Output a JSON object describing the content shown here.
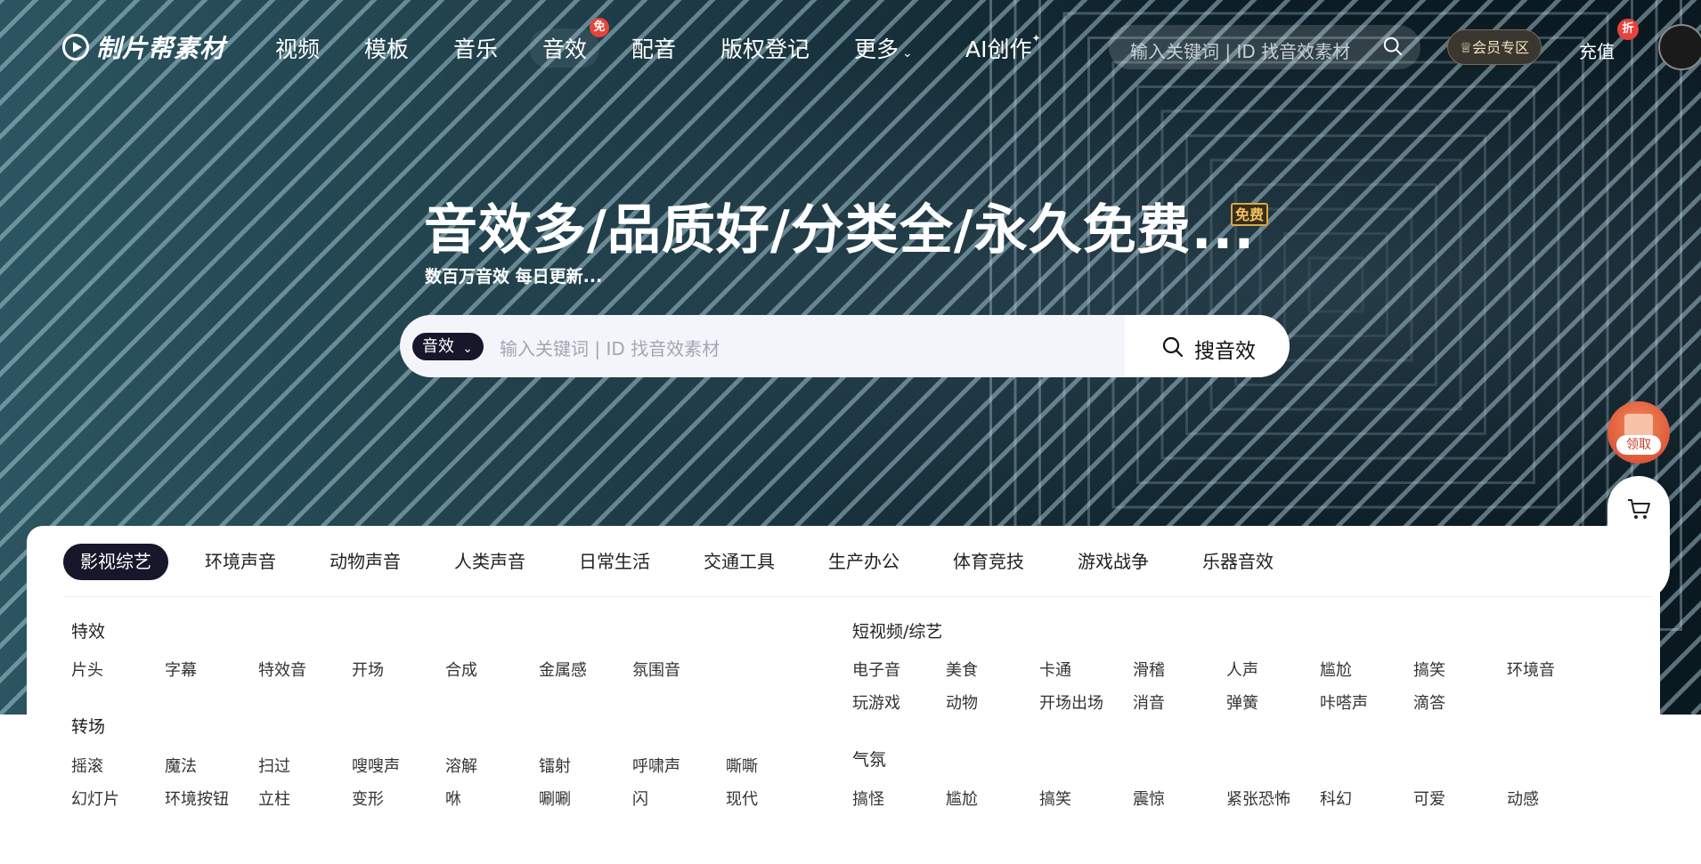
{
  "nav": {
    "logo_text": "制片帮素材",
    "items": [
      {
        "label": "视频"
      },
      {
        "label": "模板"
      },
      {
        "label": "音乐"
      },
      {
        "label": "音效",
        "badge": "免"
      },
      {
        "label": "配音"
      },
      {
        "label": "版权登记"
      },
      {
        "label": "更多"
      },
      {
        "label": "AI创作"
      }
    ],
    "search_placeholder": "输入关键词 | ID 找音效素材",
    "vip_label": "会员专区",
    "recharge_label": "充值",
    "recharge_badge": "折"
  },
  "hero": {
    "headline": "音效多/品质好/分类全/永久免费...",
    "free_tag": "免费",
    "subheadline": "数百万音效 每日更新...",
    "search": {
      "type_label": "音效",
      "placeholder": "输入关键词 | ID 找音效素材",
      "button_label": "搜音效"
    }
  },
  "floating": {
    "gift_label": "领取",
    "icons": [
      "cart-icon",
      "headset-icon"
    ]
  },
  "categories": {
    "tabs": [
      "影视综艺",
      "环境声音",
      "动物声音",
      "人类声音",
      "日常生活",
      "交通工具",
      "生产办公",
      "体育竞技",
      "游戏战争",
      "乐器音效"
    ],
    "active_tab": "影视综艺",
    "groups": [
      {
        "title": "特效",
        "rows": [
          [
            "片头",
            "字幕",
            "特效音",
            "开场",
            "合成",
            "金属感",
            "氛围音"
          ]
        ]
      },
      {
        "title": "短视频/综艺",
        "rows": [
          [
            "电子音",
            "美食",
            "卡通",
            "滑稽",
            "人声",
            "尴尬",
            "搞笑",
            "环境音"
          ],
          [
            "玩游戏",
            "动物",
            "开场出场",
            "消音",
            "弹簧",
            "咔嗒声",
            "滴答"
          ]
        ]
      },
      {
        "title": "转场",
        "rows": [
          [
            "摇滚",
            "魔法",
            "扫过",
            "嗖嗖声",
            "溶解",
            "镭射",
            "呼啸声",
            "嘶嘶"
          ],
          [
            "幻灯片",
            "环境按钮",
            "立柱",
            "变形",
            "咻",
            "唰唰",
            "闪",
            "现代"
          ]
        ]
      },
      {
        "title": "气氛",
        "rows": [
          [
            "搞怪",
            "尴尬",
            "搞笑",
            "震惊",
            "紧张恐怖",
            "科幻",
            "可爱",
            "动感"
          ]
        ]
      }
    ]
  }
}
